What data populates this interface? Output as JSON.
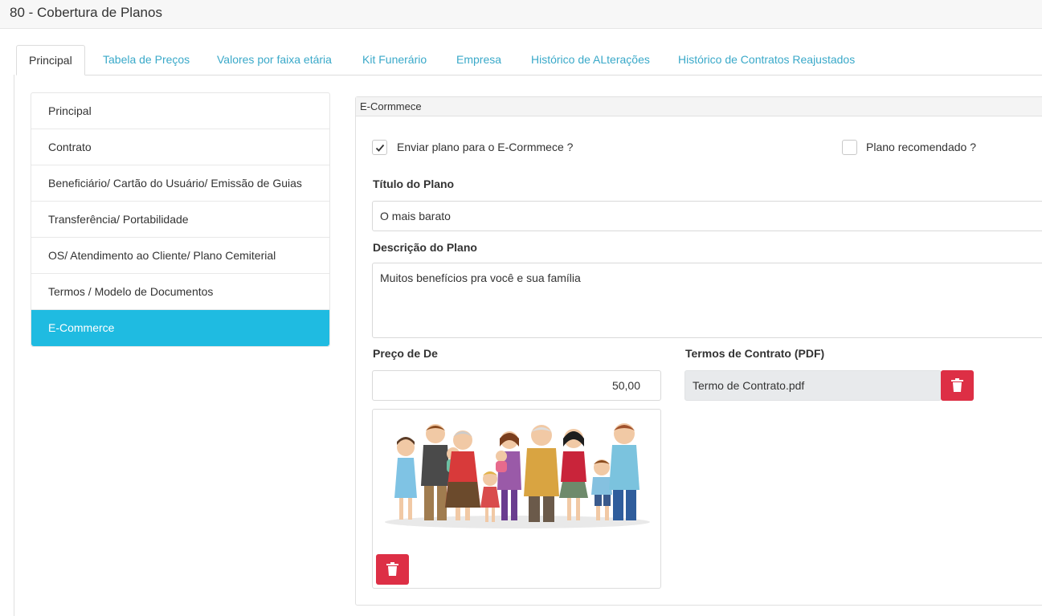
{
  "window": {
    "title": "80 - Cobertura de Planos"
  },
  "tabs": [
    {
      "label": "Principal"
    },
    {
      "label": "Tabela de Preços"
    },
    {
      "label": "Valores por faixa etária"
    },
    {
      "label": "Kit Funerário"
    },
    {
      "label": "Empresa"
    },
    {
      "label": "Histórico de ALterações"
    },
    {
      "label": "Histórico de Contratos Reajustados"
    }
  ],
  "sidebar": {
    "items": [
      {
        "label": "Principal"
      },
      {
        "label": "Contrato"
      },
      {
        "label": "Beneficiário/ Cartão do Usuário/ Emissão de Guias"
      },
      {
        "label": "Transferência/ Portabilidade"
      },
      {
        "label": "OS/ Atendimento ao Cliente/ Plano Cemiterial"
      },
      {
        "label": "Termos / Modelo de Documentos"
      },
      {
        "label": "E-Commerce"
      }
    ],
    "active": "E-Commerce"
  },
  "ecommerce": {
    "header": "E-Cormmece",
    "send_label": "Enviar plano para o E-Cormmece ?",
    "send_checked": true,
    "recommended_label": "Plano recomendado ?",
    "recommended_checked": false,
    "title_label": "Título do Plano",
    "title_value": "O mais barato",
    "description_label": "Descrição do Plano",
    "description_value": "Muitos benefícios pra você e sua família",
    "price_label": "Preço de De",
    "price_value": "50,00",
    "terms_label": "Termos de Contrato (PDF)",
    "terms_value": "Termo de Contrato.pdf"
  },
  "icons": {
    "check": "check-icon",
    "delete": "trash-icon"
  },
  "colors": {
    "accent": "#1fbbe1",
    "tab_link": "#3aa9c9",
    "danger": "#dd2f45"
  }
}
